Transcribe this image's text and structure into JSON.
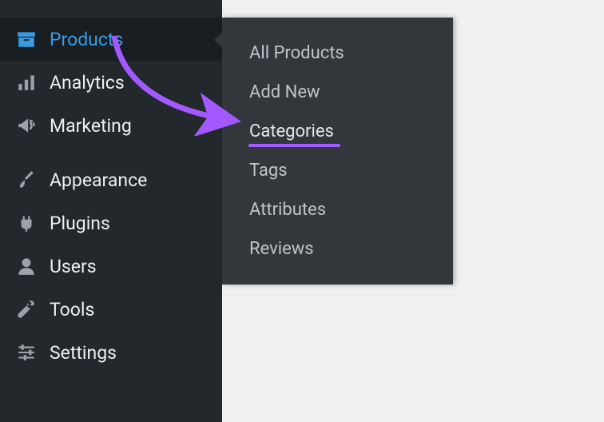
{
  "colors": {
    "accent": "#399ce3",
    "annotation": "#a259ff",
    "sidebar_bg": "#23282d",
    "flyout_bg": "#32373c"
  },
  "sidebar": {
    "active_index": 0,
    "items": [
      {
        "label": "Products",
        "icon": "archive-icon"
      },
      {
        "label": "Analytics",
        "icon": "bars-icon"
      },
      {
        "label": "Marketing",
        "icon": "megaphone-icon"
      },
      {
        "label": "Appearance",
        "icon": "paintbrush-icon"
      },
      {
        "label": "Plugins",
        "icon": "plug-icon"
      },
      {
        "label": "Users",
        "icon": "user-icon"
      },
      {
        "label": "Tools",
        "icon": "wrench-icon"
      },
      {
        "label": "Settings",
        "icon": "sliders-icon"
      }
    ]
  },
  "flyout": {
    "highlighted_index": 2,
    "items": [
      {
        "label": "All Products"
      },
      {
        "label": "Add New"
      },
      {
        "label": "Categories"
      },
      {
        "label": "Tags"
      },
      {
        "label": "Attributes"
      },
      {
        "label": "Reviews"
      }
    ]
  },
  "annotation": {
    "target": "Categories"
  }
}
